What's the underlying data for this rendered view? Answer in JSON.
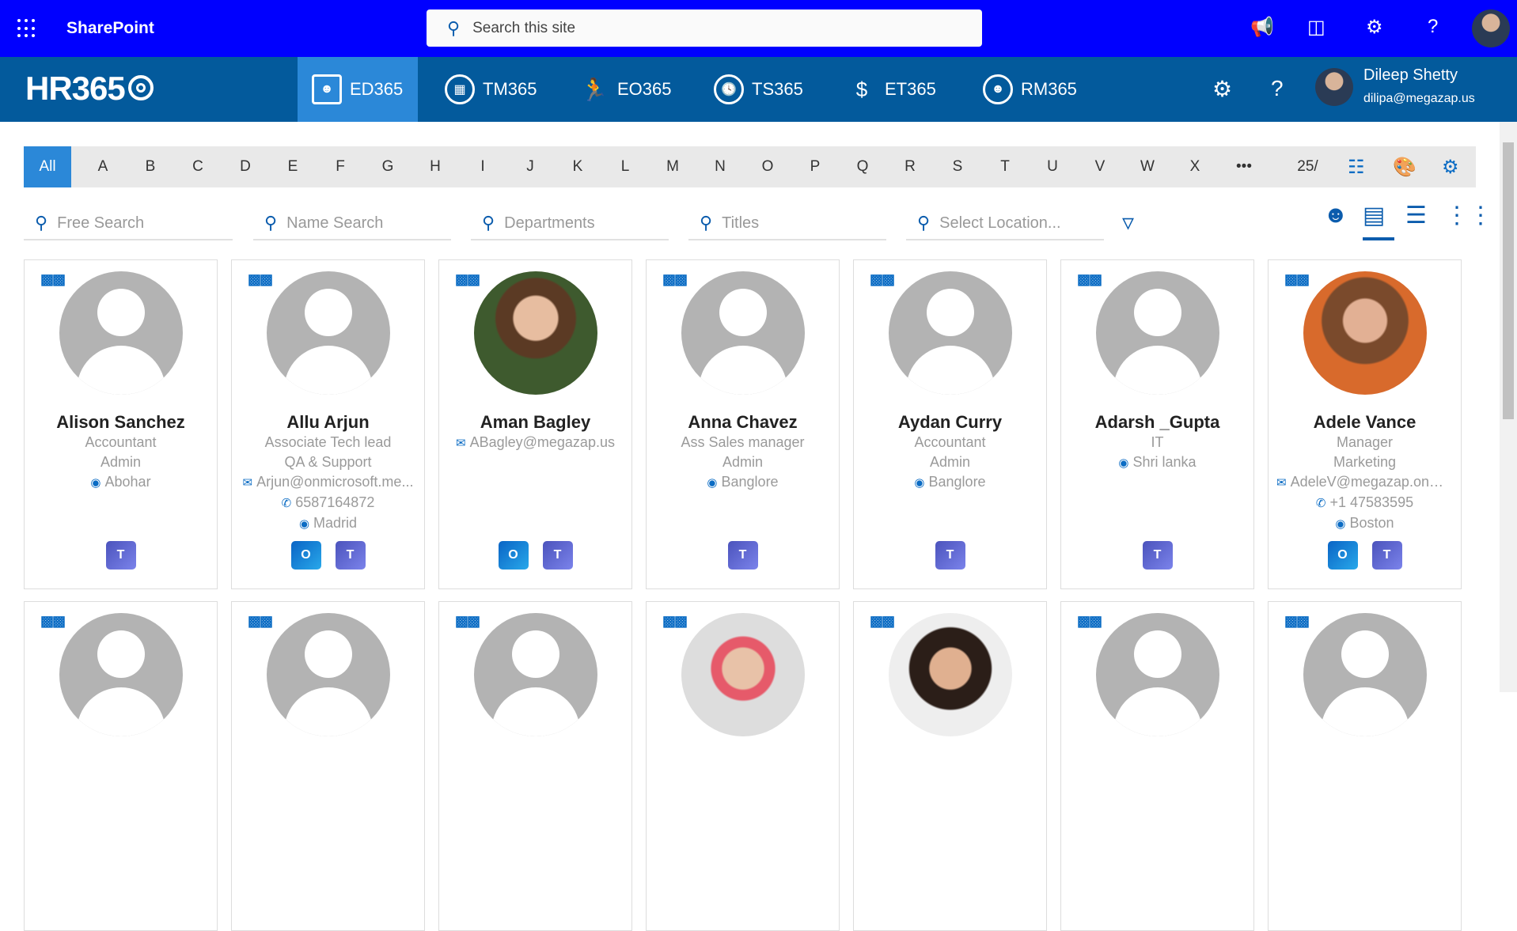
{
  "topbar": {
    "app_name": "SharePoint",
    "search_placeholder": "Search this site",
    "icons": [
      "megaphone-icon",
      "teams-apps-icon",
      "gear-icon",
      "help-icon"
    ]
  },
  "hrbar": {
    "logo": "HR365",
    "tabs": [
      {
        "label": "ED365",
        "active": true
      },
      {
        "label": "TM365"
      },
      {
        "label": "EO365"
      },
      {
        "label": "TS365"
      },
      {
        "label": "ET365"
      },
      {
        "label": "RM365"
      }
    ],
    "user": {
      "name": "Dileep Shetty",
      "email": "dilipa@megazap.us"
    }
  },
  "alphabet": {
    "all": "All",
    "letters": [
      "A",
      "B",
      "C",
      "D",
      "E",
      "F",
      "G",
      "H",
      "I",
      "J",
      "K",
      "L",
      "M",
      "N",
      "O",
      "P",
      "Q",
      "R",
      "S",
      "T",
      "U",
      "V",
      "W",
      "X"
    ],
    "more": "•••",
    "page_size": "25/"
  },
  "filters": {
    "free": "Free Search",
    "name": "Name Search",
    "departments": "Departments",
    "titles": "Titles",
    "location": "Select Location..."
  },
  "cards": [
    {
      "name": "Alison Sanchez",
      "lines": [
        {
          "t": "Accountant"
        },
        {
          "t": "Admin"
        },
        {
          "t": "Abohar",
          "icon": "location"
        }
      ],
      "apps": [
        "teams"
      ],
      "pic": "ph"
    },
    {
      "name": "Allu Arjun",
      "lines": [
        {
          "t": "Associate Tech lead"
        },
        {
          "t": "QA & Support"
        },
        {
          "t": "Arjun@onmicrosoft.me...",
          "icon": "mail"
        },
        {
          "t": "6587164872",
          "icon": "phone"
        },
        {
          "t": "Madrid",
          "icon": "location"
        }
      ],
      "apps": [
        "outlook",
        "teams"
      ],
      "pic": "ph"
    },
    {
      "name": "Aman Bagley",
      "lines": [
        {
          "t": "ABagley@megazap.us",
          "icon": "mail"
        }
      ],
      "apps": [
        "outlook",
        "teams"
      ],
      "pic": "photo"
    },
    {
      "name": "Anna Chavez",
      "lines": [
        {
          "t": "Ass Sales manager"
        },
        {
          "t": "Admin"
        },
        {
          "t": "Banglore",
          "icon": "location"
        }
      ],
      "apps": [
        "teams"
      ],
      "pic": "ph"
    },
    {
      "name": "Aydan Curry",
      "lines": [
        {
          "t": "Accountant"
        },
        {
          "t": "Admin"
        },
        {
          "t": "Banglore",
          "icon": "location"
        }
      ],
      "apps": [
        "teams"
      ],
      "pic": "ph"
    },
    {
      "name": "Adarsh _Gupta",
      "lines": [
        {
          "t": "IT"
        },
        {
          "t": "Shri lanka",
          "icon": "location"
        }
      ],
      "apps": [
        "teams"
      ],
      "pic": "ph"
    },
    {
      "name": "Adele Vance",
      "lines": [
        {
          "t": "Manager"
        },
        {
          "t": "Marketing"
        },
        {
          "t": "AdeleV@megazap.onmic...",
          "icon": "mail"
        },
        {
          "t": "+1 47583595",
          "icon": "phone"
        },
        {
          "t": "Boston",
          "icon": "location"
        }
      ],
      "apps": [
        "outlook",
        "teams"
      ],
      "pic": "photo2"
    }
  ],
  "cards_row2": [
    "ph",
    "ph",
    "ph",
    "photo3",
    "photo4",
    "ph",
    "ph"
  ],
  "colors": {
    "topbar": "#0000ff",
    "hrbar": "#035a9c",
    "accent": "#2b88d8"
  }
}
